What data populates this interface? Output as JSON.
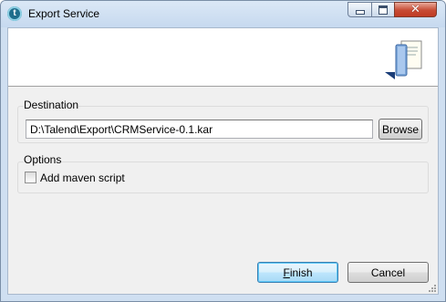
{
  "window": {
    "title": "Export Service",
    "icons": {
      "app": "talend-app-icon",
      "minimize": "minimize-icon",
      "maximize": "maximize-icon",
      "close": "close-icon",
      "banner": "export-wizard-icon"
    }
  },
  "destination": {
    "group_label": "Destination",
    "path_value": "D:\\Talend\\Export\\CRMService-0.1.kar",
    "browse_label": "Browse"
  },
  "options": {
    "group_label": "Options",
    "add_maven_label": "Add maven script",
    "add_maven_checked": false
  },
  "footer": {
    "finish_hotkey": "F",
    "finish_rest": "inish",
    "cancel_label": "Cancel"
  },
  "colors": {
    "title_bar": "#c6d9ef",
    "close_button": "#c74b34",
    "default_button_border": "#3c7fb1"
  }
}
